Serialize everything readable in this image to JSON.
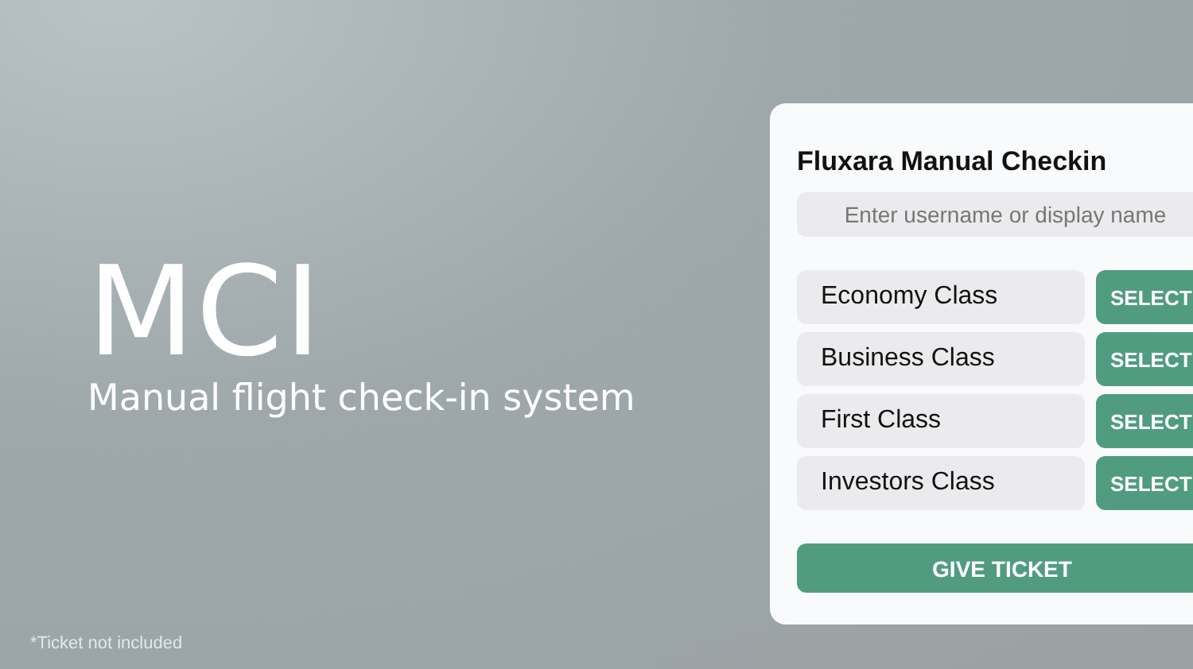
{
  "hero": {
    "title": "MCI",
    "subtitle": "Manual flight check-in system",
    "footnote": "*Ticket not included"
  },
  "card": {
    "title": "Fluxara Manual Checkin",
    "search": {
      "placeholder": "Enter username or display name"
    },
    "classes": [
      {
        "label": "Economy Class",
        "button": "SELECT"
      },
      {
        "label": "Business Class",
        "button": "SELECT"
      },
      {
        "label": "First Class",
        "button": "SELECT"
      },
      {
        "label": "Investors Class",
        "button": "SELECT"
      }
    ],
    "submit": "GIVE TICKET"
  }
}
